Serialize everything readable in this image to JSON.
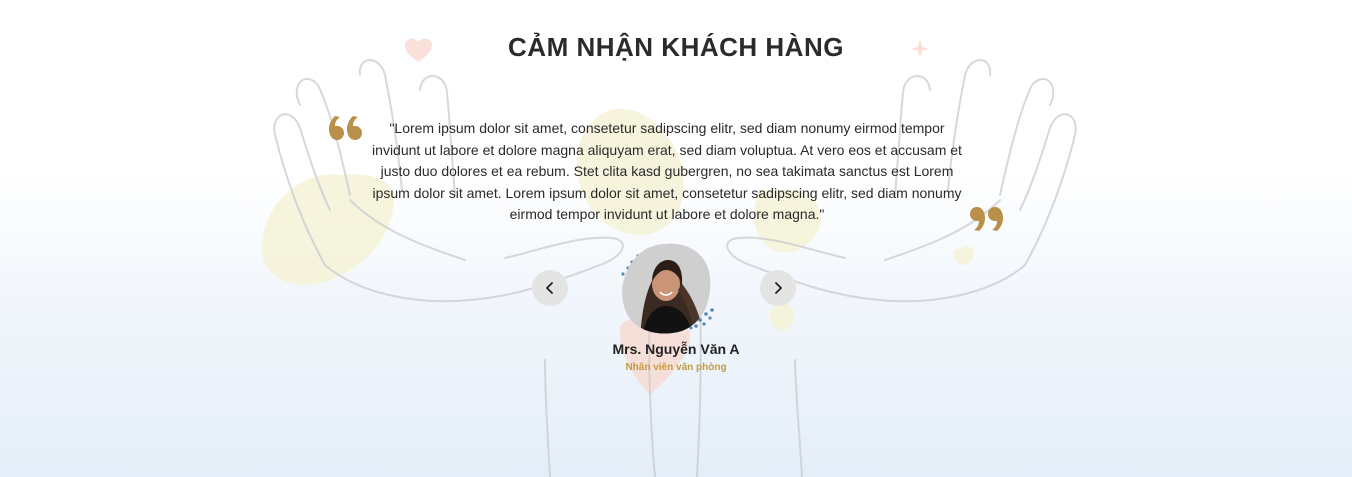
{
  "section": {
    "title": "CẢM NHẬN KHÁCH HÀNG",
    "accent_color": "#b8904a"
  },
  "testimonial": {
    "quote": "\"Lorem ipsum dolor sit amet, consetetur sadipscing elitr, sed diam nonumy eirmod tempor invidunt ut labore et dolore magna aliquyam erat, sed diam voluptua. At vero eos et accusam et justo duo dolores et ea rebum. Stet clita kasd gubergren, no sea takimata sanctus est Lorem ipsum dolor sit amet. Lorem ipsum dolor sit amet, consetetur sadipscing elitr, sed diam nonumy eirmod tempor invidunt ut labore et dolore magna.\"",
    "name": "Mrs. Nguyễn Văn A",
    "role": "Nhân viên văn phòng",
    "role_color": "#c79a3e"
  },
  "carousel": {
    "prev_icon": "chevron-left-icon",
    "next_icon": "chevron-right-icon"
  },
  "icons": {
    "open_quote": "open-quote-icon",
    "close_quote": "close-quote-icon"
  }
}
